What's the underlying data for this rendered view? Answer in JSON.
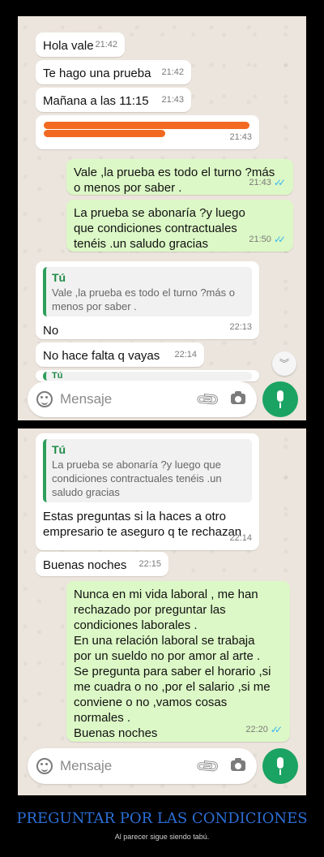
{
  "panel1": {
    "messages": [
      {
        "text": "Hola vale",
        "time": "21:42"
      },
      {
        "text": "Te hago una prueba",
        "time": "21:42"
      },
      {
        "text": "Mañana a las 11:15",
        "time": "21:43"
      },
      {
        "time": "21:43"
      },
      {
        "text": "Vale ,la prueba es todo el turno ?más o menos por saber .",
        "time": "21:43"
      },
      {
        "text": "La prueba se abonaría ?y luego que condiciones contractuales tenéis .un saludo gracias",
        "time": "21:50"
      },
      {
        "quote_author": "Tú",
        "quote_text": "Vale ,la prueba es todo el turno ?más o menos por saber .",
        "text": "No",
        "time": "22:13"
      },
      {
        "text": "No hace falta q vayas",
        "time": "22:14"
      },
      {
        "quote_author": "Tú"
      }
    ],
    "composer": {
      "placeholder": "Mensaje"
    }
  },
  "panel2": {
    "messages": [
      {
        "quote_author": "Tú",
        "quote_text": "La prueba se abonaría ?y luego que condiciones contractuales tenéis .un saludo gracias",
        "text": "Estas preguntas si la haces a otro empresario te aseguro q te rechazan",
        "time": "22:14"
      },
      {
        "text": "Buenas noches",
        "time": "22:15"
      },
      {
        "text": "Nunca en mi vida laboral , me han rechazado por preguntar las condiciones laborales .\nEn una relación laboral se trabaja por un sueldo no por amor al arte .\nSe pregunta para saber el horario ,si me cuadra o no ,por el salario ,si me conviene o no ,vamos cosas normales .\nBuenas noches",
        "time": "22:20"
      }
    ],
    "composer": {
      "placeholder": "Mensaje"
    }
  },
  "caption": {
    "title": "PREGUNTAR POR LAS CONDICIONES",
    "subtitle": "Al parecer sigue siendo tabú."
  },
  "colors": {
    "incoming": "#ffffff",
    "outgoing": "#dcf8c6",
    "accent": "#1aa362",
    "read_ticks": "#34b7f1",
    "caption_title": "#2b6fd6"
  },
  "icons": [
    "emoji-icon",
    "attach-icon",
    "camera-icon",
    "mic-icon",
    "chevron-down-icon",
    "read-ticks-icon"
  ]
}
